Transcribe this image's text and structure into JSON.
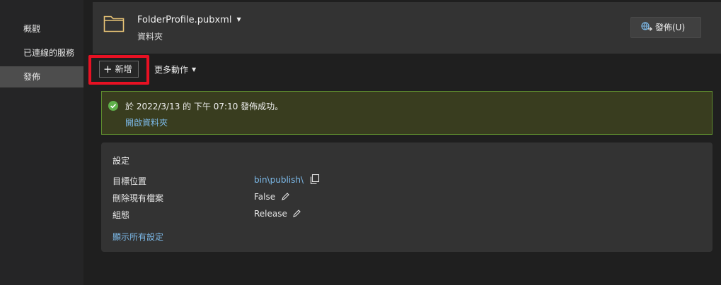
{
  "sidebar": {
    "items": [
      {
        "label": "概觀"
      },
      {
        "label": "已連線的服務"
      },
      {
        "label": "發佈"
      }
    ]
  },
  "header": {
    "profile_name": "FolderProfile.pubxml",
    "profile_type": "資料夾",
    "publish_button": "發佈(U)",
    "folder_icon": "folder-icon",
    "publish_icon": "globe-publish-icon"
  },
  "toolbar": {
    "add_label": "新增",
    "more_actions_label": "更多動作"
  },
  "notification": {
    "message": "於 2022/3/13 的 下午 07:10 發佈成功。",
    "open_folder_link": "開啟資料夾",
    "status_color": "#5fb04a"
  },
  "settings": {
    "title": "設定",
    "rows": [
      {
        "label": "目標位置",
        "value": "bin\\publish\\"
      },
      {
        "label": "刪除現有檔案",
        "value": "False"
      },
      {
        "label": "組態",
        "value": "Release"
      }
    ],
    "show_all_link": "顯示所有設定"
  },
  "colors": {
    "highlight": "#e81123",
    "link": "#7cb9e8",
    "success_border": "#5f8f2f"
  }
}
